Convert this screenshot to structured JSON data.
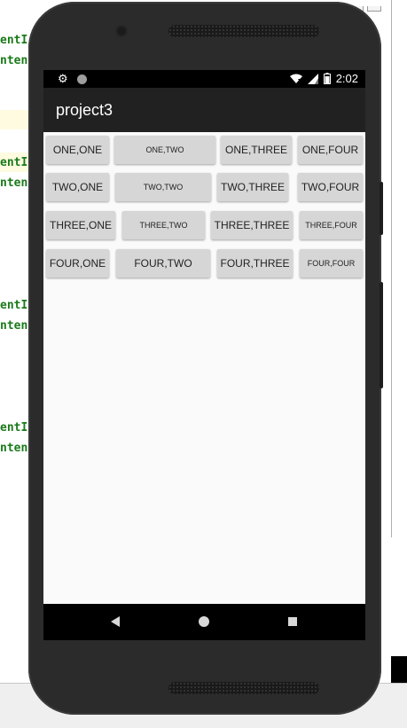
{
  "ide": {
    "code_lines": [
      {
        "text": "entI",
        "highlight": false
      },
      {
        "text": "nten",
        "highlight": false
      },
      {
        "text": "entI",
        "highlight": true
      },
      {
        "text": "nten",
        "highlight": false
      },
      {
        "text": "entI",
        "highlight": false
      },
      {
        "text": "nten",
        "highlight": false
      },
      {
        "text": "entI",
        "highlight": false
      },
      {
        "text": "nten",
        "highlight": false
      }
    ],
    "code_color": "#1a7a1a"
  },
  "status_bar": {
    "time": "2:02",
    "icons_left": [
      "gear-icon",
      "circle-icon"
    ],
    "icons_right": [
      "wifi-icon",
      "signal-icon",
      "battery-icon"
    ]
  },
  "app": {
    "title": "project3",
    "app_bar_color": "#212121"
  },
  "grid": {
    "rows": [
      [
        "ONE,ONE",
        "ONE,TWO",
        "ONE,THREE",
        "ONE,FOUR"
      ],
      [
        "TWO,ONE",
        "TWO,TWO",
        "TWO,THREE",
        "TWO,FOUR"
      ],
      [
        "THREE,ONE",
        "THREE,TWO",
        "THREE,THREE",
        "THREE,FOUR"
      ],
      [
        "FOUR,ONE",
        "FOUR,TWO",
        "FOUR,THREE",
        "FOUR,FOUR"
      ]
    ]
  },
  "nav_bar": {
    "icons": [
      "back-icon",
      "home-icon",
      "recent-apps-icon"
    ]
  }
}
